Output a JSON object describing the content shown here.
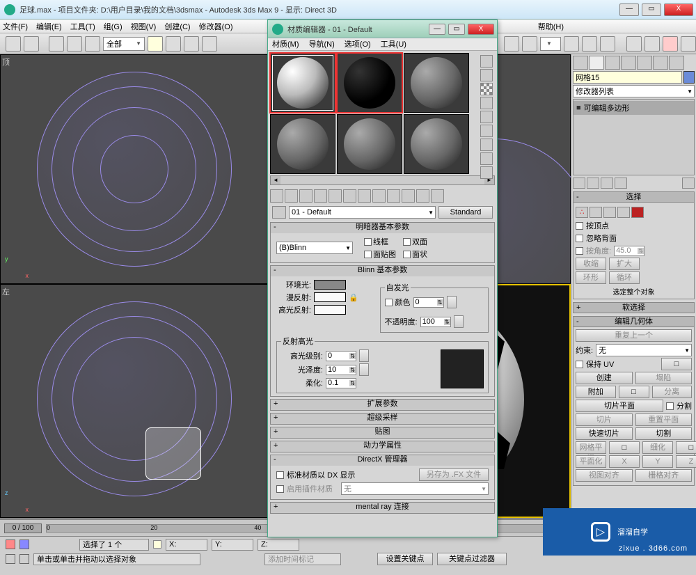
{
  "window": {
    "title": "足球.max  -  项目文件夹: D:\\用户目录\\我的文档\\3dsmax  -  Autodesk 3ds Max 9  -  显示: Direct 3D",
    "min": "—",
    "max": "▭",
    "close": "X"
  },
  "menubar": [
    "文件(F)",
    "编辑(E)",
    "工具(T)",
    "组(G)",
    "视图(V)",
    "创建(C)",
    "修改器(O)",
    "",
    "",
    "",
    "",
    "",
    "",
    "帮助(H)"
  ],
  "toolbar": {
    "combo": "全部"
  },
  "viewports": {
    "top": "顶",
    "left": "左"
  },
  "mat": {
    "title": "材质编辑器 - 01 - Default",
    "menu": [
      "材质(M)",
      "导航(N)",
      "选项(O)",
      "工具(U)"
    ],
    "name_combo": "01 - Default",
    "type_btn": "Standard",
    "roll_shader": "明暗器基本参数",
    "shader": "(B)Blinn",
    "chk_wire": "线框",
    "chk_2side": "双面",
    "chk_facemap": "面贴图",
    "chk_faceted": "面状",
    "roll_blinn": "Blinn 基本参数",
    "self_illum": "自发光",
    "color_chk": "颜色",
    "color_val": "0",
    "ambient": "环境光:",
    "diffuse": "漫反射:",
    "specular": "高光反射:",
    "opacity": "不透明度:",
    "opacity_val": "100",
    "spec_grp": "反射高光",
    "spec_level": "高光级别:",
    "spec_level_val": "0",
    "gloss": "光泽度:",
    "gloss_val": "10",
    "soften": "柔化:",
    "soften_val": "0.1",
    "roll_ext": "扩展参数",
    "roll_ss": "超级采样",
    "roll_maps": "贴图",
    "roll_dyn": "动力学属性",
    "roll_dx": "DirectX 管理器",
    "dx_std": "标准材质以 DX 显示",
    "dx_save": "另存为 .FX 文件",
    "dx_plugin": "启用插件材质",
    "dx_none": "无",
    "roll_mr": "mental ray 连接"
  },
  "cmd": {
    "obj_name": "网格15",
    "modlist_label": "修改器列表",
    "modifier": "可编辑多边形",
    "roll_sel": "选择",
    "by_vertex": "按顶点",
    "ignore_back": "忽略背面",
    "by_angle": "按角度:",
    "angle": "45.0",
    "shrink": "收缩",
    "grow": "扩大",
    "ring": "环形",
    "loop": "循环",
    "sel_whole": "选定整个对象",
    "roll_soft": "软选择",
    "roll_editgeo": "编辑几何体",
    "repeat": "重复上一个",
    "constrain": "约束:",
    "none": "无",
    "preserve_uv": "保持 UV",
    "create": "创建",
    "collapse": "塌陷",
    "attach": "附加",
    "detach": "分离",
    "slice_plane": "切片平面",
    "split": "分割",
    "slice": "切片",
    "reset_plane": "重置平面",
    "quick_slice": "快速切片",
    "cut": "切割",
    "msmooth": "网格平滑",
    "tess": "细化",
    "planar": "平面化",
    "xyz": [
      "X",
      "Y",
      "Z"
    ],
    "view_align": "视图对齐",
    "grid_align": "栅格对齐"
  },
  "timeline": {
    "pos": "0 / 100",
    "ticks": [
      "0",
      "",
      "20",
      "",
      "40"
    ]
  },
  "status": {
    "sel": "选择了 1 个",
    "coords_x": "X:",
    "coords_y": "Y:",
    "coords_z": "Z:",
    "hint": "单击或单击并拖动以选择对象",
    "addtime": "添加时间标记",
    "setkey": "设置关键点",
    "keyfilter": "关键点过滤器"
  },
  "watermark": {
    "brand": "溜溜自学",
    "url": "zixue . 3d66.com"
  }
}
